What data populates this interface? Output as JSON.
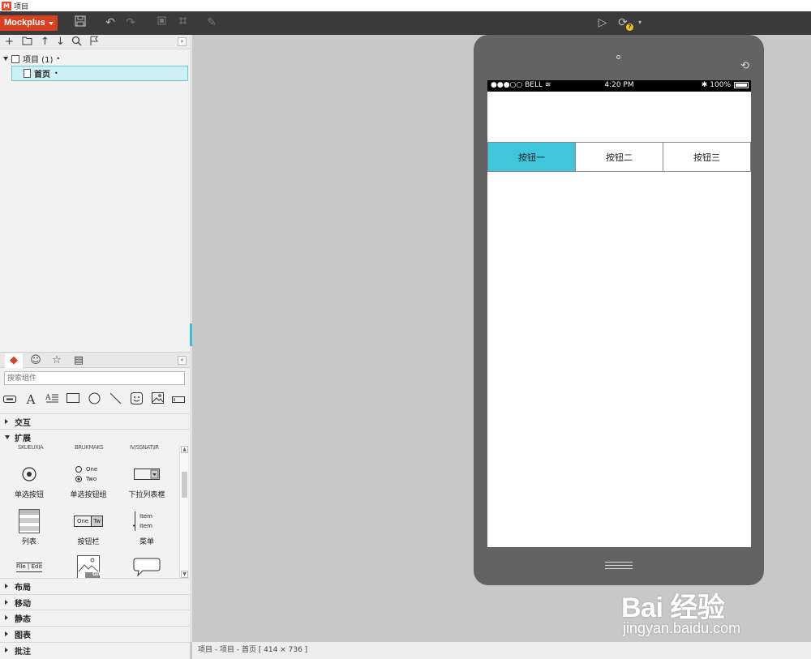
{
  "window": {
    "title": "项目"
  },
  "toolbar": {
    "brand": "Mockplus",
    "badge": "?",
    "icons": [
      "save-icon",
      "undo-icon",
      "redo-icon",
      "fit-icon",
      "grid-icon",
      "brush-icon",
      "play-icon",
      "sync-icon",
      "chevron-down-icon"
    ]
  },
  "project_tree": {
    "root_label": "项目 (1)",
    "root_marker": "•",
    "page_label": "首页",
    "page_marker": "•"
  },
  "library": {
    "search_placeholder": "搜索组件",
    "sections_top": [
      {
        "label": "交互",
        "expanded": false
      },
      {
        "label": "扩展",
        "expanded": true
      }
    ],
    "cutoff_labels": [
      "SKUEUXIA",
      "BRUKMAKS",
      "IV/SSNAT\\IR"
    ],
    "widgets": [
      {
        "label": "单选按钮"
      },
      {
        "label": "单选按钮组",
        "option1": "One",
        "option2": "Two"
      },
      {
        "label": "下拉列表框"
      },
      {
        "label": "列表"
      },
      {
        "label": "按钮栏",
        "b1": "One",
        "b2": "Tw"
      },
      {
        "label": "菜单",
        "item1": "Item",
        "item2": "Item"
      },
      {
        "label": "File | Edit"
      },
      {
        "label": "GIF"
      },
      {
        "label": ""
      }
    ],
    "sections_bottom": [
      {
        "label": "布局"
      },
      {
        "label": "移动"
      },
      {
        "label": "静态"
      },
      {
        "label": "图表"
      },
      {
        "label": "批注"
      }
    ]
  },
  "device": {
    "carrier": "●●●○○ BELL",
    "time": "4:20 PM",
    "battery": "100%",
    "tabs": [
      {
        "label": "按钮一",
        "active": true
      },
      {
        "label": "按钮二",
        "active": false
      },
      {
        "label": "按钮三",
        "active": false
      }
    ],
    "accent_color": "#3fc5dc"
  },
  "status": {
    "text": "项目 - 项目 - 首页 [ 414 × 736 ]"
  },
  "watermark": {
    "line1": "Bai 经验",
    "line2": "jingyan.baidu.com"
  }
}
